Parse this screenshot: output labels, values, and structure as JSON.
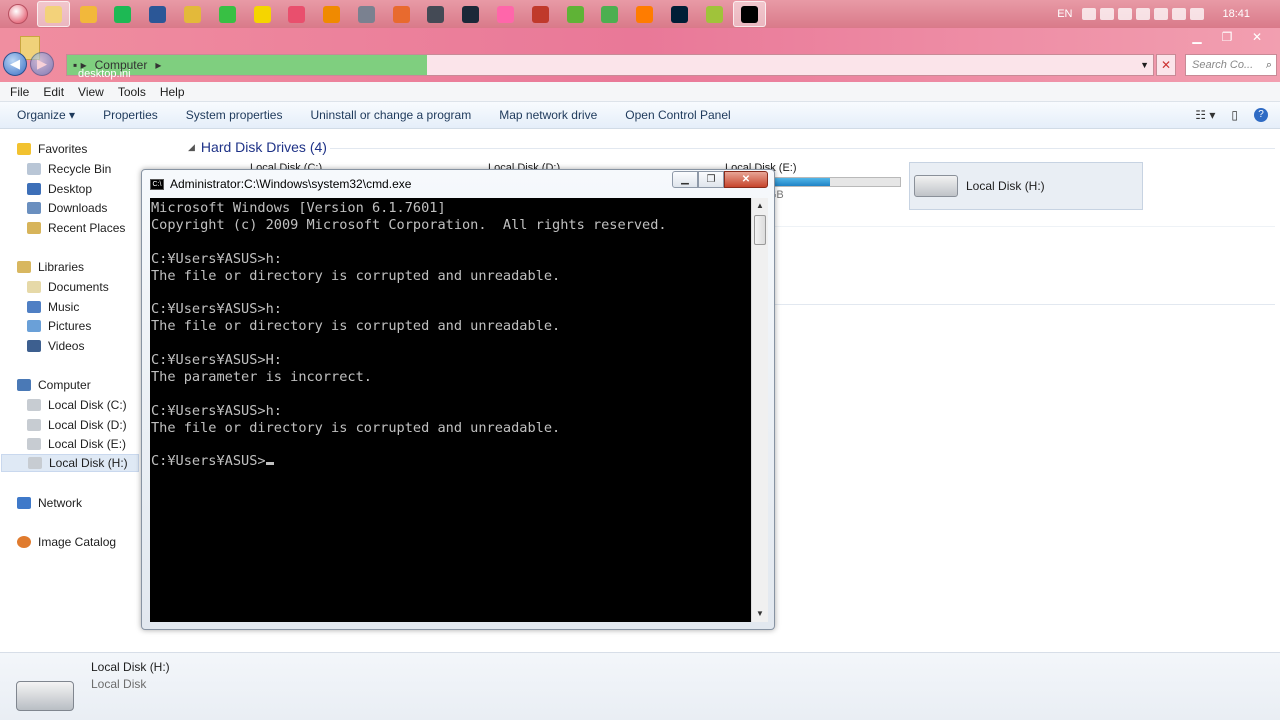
{
  "taskbar": {
    "apps": [
      {
        "name": "explorer-taskbar-icon",
        "color": "#f3d27a"
      },
      {
        "name": "app-taskbar-icon",
        "color": "#f2b83b"
      },
      {
        "name": "spotify-taskbar-icon",
        "color": "#1db954"
      },
      {
        "name": "word-taskbar-icon",
        "color": "#2b5797"
      },
      {
        "name": "tool-taskbar-icon",
        "color": "#e3b93a"
      },
      {
        "name": "line-taskbar-icon",
        "color": "#38c044"
      },
      {
        "name": "chat-taskbar-icon",
        "color": "#f5d500"
      },
      {
        "name": "paint-taskbar-icon",
        "color": "#e94f6d"
      },
      {
        "name": "vlc-taskbar-icon",
        "color": "#f08a00"
      },
      {
        "name": "app2-taskbar-icon",
        "color": "#7a8190"
      },
      {
        "name": "app3-taskbar-icon",
        "color": "#e86a2e"
      },
      {
        "name": "media-taskbar-icon",
        "color": "#444a55"
      },
      {
        "name": "steam-taskbar-icon",
        "color": "#1b2838"
      },
      {
        "name": "osu-taskbar-icon",
        "color": "#ff66aa"
      },
      {
        "name": "app4-taskbar-icon",
        "color": "#c0392b"
      },
      {
        "name": "utorrent-taskbar-icon",
        "color": "#5fb336"
      },
      {
        "name": "chrome-taskbar-icon",
        "color": "#4caf50"
      },
      {
        "name": "illustrator-taskbar-icon",
        "color": "#ff7c00"
      },
      {
        "name": "photoshop-taskbar-icon",
        "color": "#001e36"
      },
      {
        "name": "app5-taskbar-icon",
        "color": "#a0c33a"
      },
      {
        "name": "cmd-taskbar-icon",
        "color": "#000000"
      }
    ],
    "lang": "EN",
    "clock": "18:41"
  },
  "explorer": {
    "address": {
      "crumb": "Computer",
      "desktop_file": "desktop.ini"
    },
    "search_placeholder": "Search Co...",
    "menu": [
      "File",
      "Edit",
      "View",
      "Tools",
      "Help"
    ],
    "commands": [
      "Organize ▾",
      "Properties",
      "System properties",
      "Uninstall or change a program",
      "Map network drive",
      "Open Control Panel"
    ],
    "nav": {
      "favorites": "Favorites",
      "recycle_bin": "Recycle Bin",
      "desktop": "Desktop",
      "downloads": "Downloads",
      "recent_places": "Recent Places",
      "libraries": "Libraries",
      "documents": "Documents",
      "music": "Music",
      "pictures": "Pictures",
      "videos": "Videos",
      "computer": "Computer",
      "disk_c": "Local Disk (C:)",
      "disk_d": "Local Disk (D:)",
      "disk_e": "Local Disk (E:)",
      "disk_h": "Local Disk (H:)",
      "network": "Network",
      "image_catalog": "Image Catalog"
    },
    "group_title": "Hard Disk Drives (4)",
    "drives": {
      "c": {
        "label": "Local Disk (C:)"
      },
      "d": {
        "label": "Local Disk (D:)",
        "used_fraction": 0.8
      },
      "e": {
        "label": "Local Disk (E:)",
        "free_text": "e of 128 GB",
        "used_fraction": 0.6
      },
      "h": {
        "label": "Local Disk (H:)"
      }
    },
    "details": {
      "name": "Local Disk (H:)",
      "type": "Local Disk"
    }
  },
  "cmd": {
    "title_prefix": "Administrator: ",
    "title_path": "C:\\Windows\\system32\\cmd.exe",
    "lines": [
      "Microsoft Windows [Version 6.1.7601]",
      "Copyright (c) 2009 Microsoft Corporation.  All rights reserved.",
      "",
      "C:¥Users¥ASUS>h:",
      "The file or directory is corrupted and unreadable.",
      "",
      "C:¥Users¥ASUS>h:",
      "The file or directory is corrupted and unreadable.",
      "",
      "C:¥Users¥ASUS>H:",
      "The parameter is incorrect.",
      "",
      "C:¥Users¥ASUS>h:",
      "The file or directory is corrupted and unreadable.",
      ""
    ],
    "prompt": "C:¥Users¥ASUS>"
  }
}
